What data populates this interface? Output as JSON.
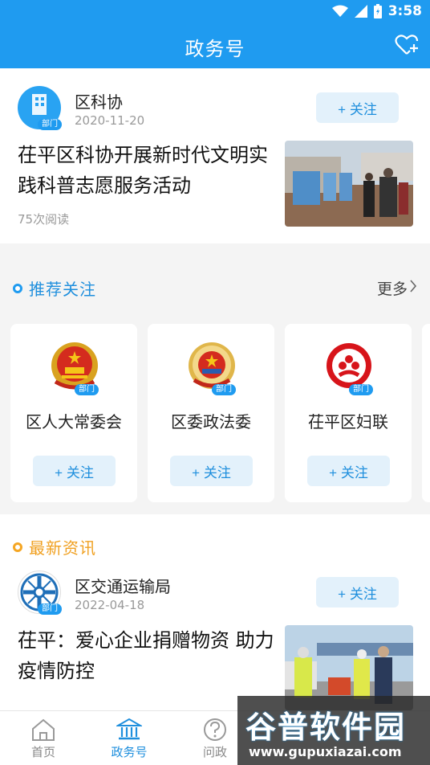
{
  "status_bar": {
    "time": "3:58"
  },
  "header": {
    "title": "政务号"
  },
  "top_article": {
    "source_name": "区科协",
    "source_badge": "部门",
    "date": "2020-11-20",
    "follow_label": "+ 关注",
    "headline": "茌平区科协开展新时代文明实践科普志愿服务活动",
    "reads": "75次阅读"
  },
  "recommend": {
    "title": "推荐关注",
    "more_label": "更多",
    "items": [
      {
        "name": "区人大常委会",
        "badge": "部门",
        "follow_label": "+ 关注"
      },
      {
        "name": "区委政法委",
        "badge": "部门",
        "follow_label": "+ 关注"
      },
      {
        "name": "茌平区妇联",
        "badge": "部门",
        "follow_label": "+ 关注"
      }
    ]
  },
  "latest": {
    "title": "最新资讯",
    "article": {
      "source_name": "区交通运输局",
      "source_badge": "部门",
      "date": "2022-04-18",
      "follow_label": "+ 关注",
      "headline": "茌平：爱心企业捐赠物资 助力疫情防控"
    }
  },
  "tabbar": {
    "tabs": [
      {
        "label": "首页",
        "icon": "home-icon"
      },
      {
        "label": "政务号",
        "icon": "government-building-icon"
      },
      {
        "label": "问政",
        "icon": "question-icon"
      }
    ]
  },
  "watermark": {
    "line1": "谷普软件园",
    "line2": "www.gupuxiazai.com"
  },
  "colors": {
    "primary": "#1f9bf0",
    "accent_orange": "#f0a020"
  }
}
